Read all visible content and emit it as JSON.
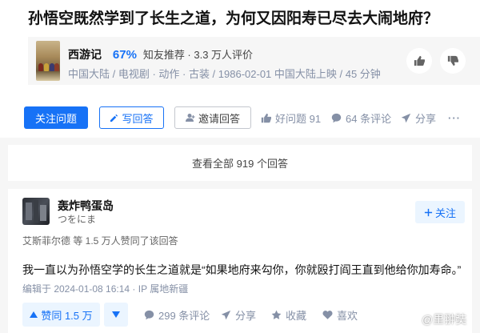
{
  "question": {
    "title": "孙悟空既然学到了长生之道，为何又因阳寿已尽去大闹地府？"
  },
  "movie": {
    "name": "西游记",
    "rating": "67%",
    "rating_label": "知友推荐 · 3.3 万人评价",
    "meta": "中国大陆 / 电视剧 · 动作 · 古装 / 1986-02-01 中国大陆上映 / 45 分钟"
  },
  "actions": {
    "follow_question": "关注问题",
    "write_answer": "写回答",
    "invite_answer": "邀请回答",
    "good_question": "好问题 91",
    "comments": "64 条评论",
    "share": "分享",
    "more": "···"
  },
  "all_answers": "查看全部 919 个回答",
  "answer": {
    "author_name": "轰炸鸭蛋岛",
    "author_bio": "つをにま",
    "follow": "关注",
    "voters": "艾斯菲尔德 等 1.5 万人赞同了该回答",
    "content": "我一直以为孙悟空学的长生之道就是“如果地府来勾你，你就殴打阎王直到他给你加寿命。”",
    "edit_time": "编辑于 2024-01-08 16:14 · IP 属地新疆",
    "vote_up": "赞同 1.5 万",
    "comments": "299 条评论",
    "share": "分享",
    "favorite": "收藏",
    "like": "喜欢"
  },
  "watermark": "@里翀奘",
  "colors": {
    "brand": "#1772f6",
    "vote_bg": "#ebf5ff",
    "muted": "#8590a6"
  },
  "icons": [
    "thumb-up-icon",
    "thumb-down-icon",
    "pencil-icon",
    "invite-icon",
    "comment-icon",
    "share-icon",
    "star-icon",
    "heart-icon",
    "plus-icon",
    "caret-up-icon",
    "caret-down-icon",
    "weibo-icon"
  ]
}
